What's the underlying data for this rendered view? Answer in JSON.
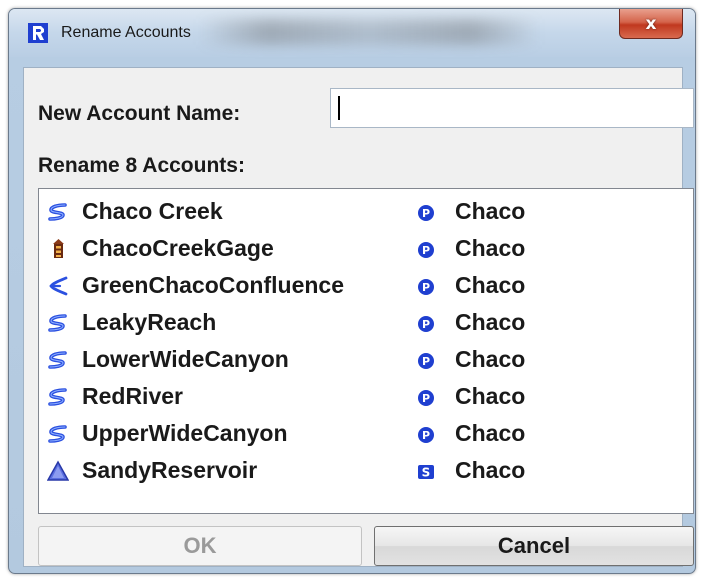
{
  "window": {
    "title": "Rename Accounts",
    "close_label": "x"
  },
  "form": {
    "new_name_label": "New Account Name:",
    "new_name_value": "",
    "rename_count_label": "Rename 8 Accounts:"
  },
  "accounts": [
    {
      "name": "Chaco Creek",
      "icon": "reach-icon",
      "type": "P",
      "owner": "Chaco"
    },
    {
      "name": "ChacoCreekGage",
      "icon": "gage-icon",
      "type": "P",
      "owner": "Chaco"
    },
    {
      "name": "GreenChacoConfluence",
      "icon": "confluence-icon",
      "type": "P",
      "owner": "Chaco"
    },
    {
      "name": "LeakyReach",
      "icon": "reach-icon",
      "type": "P",
      "owner": "Chaco"
    },
    {
      "name": "LowerWideCanyon",
      "icon": "reach-icon",
      "type": "P",
      "owner": "Chaco"
    },
    {
      "name": "RedRiver",
      "icon": "reach-icon",
      "type": "P",
      "owner": "Chaco"
    },
    {
      "name": "UpperWideCanyon",
      "icon": "reach-icon",
      "type": "P",
      "owner": "Chaco"
    },
    {
      "name": "SandyReservoir",
      "icon": "reservoir-icon",
      "type": "S",
      "owner": "Chaco"
    }
  ],
  "buttons": {
    "ok_label": "OK",
    "cancel_label": "Cancel"
  },
  "colors": {
    "accent_blue": "#1f3fd0",
    "close_red": "#c0381f"
  }
}
